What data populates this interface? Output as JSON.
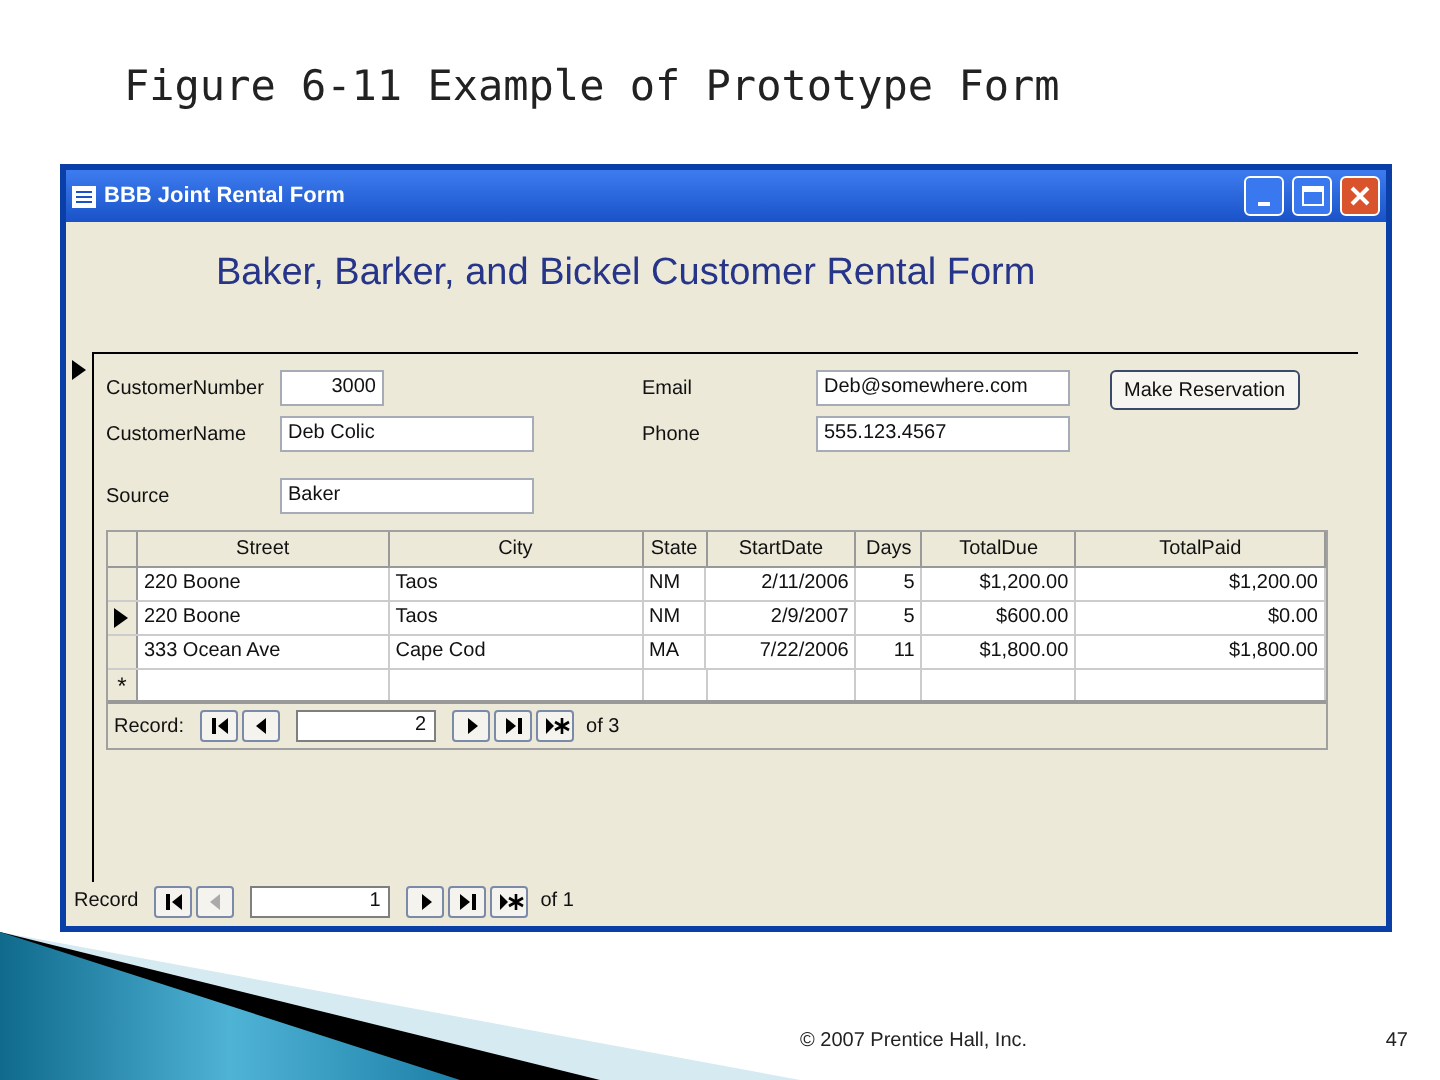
{
  "slide": {
    "title": "Figure 6-11 Example of Prototype Form",
    "footer": "© 2007 Prentice Hall, Inc.",
    "page_number": "47"
  },
  "window": {
    "title": "BBB Joint Rental Form"
  },
  "form": {
    "heading": "Baker, Barker, and Bickel Customer Rental Form",
    "left_fields": [
      {
        "label": "CustomerNumber",
        "value": "3000",
        "kind": "number"
      },
      {
        "label": "CustomerName",
        "value": "Deb Colic",
        "kind": "text"
      },
      {
        "label": "Source",
        "value": "Baker",
        "kind": "text"
      }
    ],
    "right_fields": [
      {
        "label": "Email",
        "value": "Deb@somewhere.com",
        "kind": "text"
      },
      {
        "label": "Phone",
        "value": "555.123.4567",
        "kind": "text"
      }
    ],
    "button": "Make Reservation"
  },
  "subform": {
    "columns": [
      "Street",
      "City",
      "State",
      "StartDate",
      "Days",
      "TotalDue",
      "TotalPaid"
    ],
    "rows": [
      {
        "selected": false,
        "cells": [
          "220 Boone",
          "Taos",
          "NM",
          "2/11/2006",
          "5",
          "$1,200.00",
          "$1,200.00"
        ]
      },
      {
        "selected": true,
        "cells": [
          "220 Boone",
          "Taos",
          "NM",
          "2/9/2007",
          "5",
          "$600.00",
          "$0.00"
        ]
      },
      {
        "selected": false,
        "cells": [
          "333 Ocean Ave",
          "Cape Cod",
          "MA",
          "7/22/2006",
          "11",
          "$1,800.00",
          "$1,800.00"
        ]
      }
    ],
    "new_row_mark": "*",
    "navigator": {
      "label": "Record:",
      "current": "2",
      "total": "of 3",
      "prev_disabled": false
    }
  },
  "navigator": {
    "label": "Record",
    "current": "1",
    "total": "of 1",
    "prev_disabled": true
  }
}
